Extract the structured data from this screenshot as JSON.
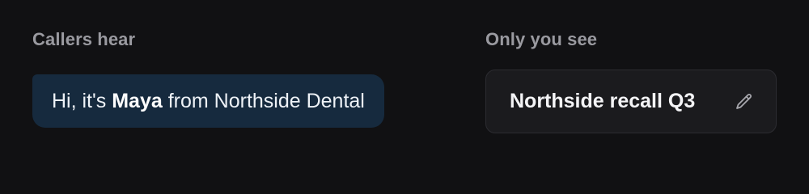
{
  "callers_hear": {
    "label": "Callers hear",
    "greeting_prefix": "Hi, it's ",
    "agent_name": "Maya",
    "greeting_suffix": " from Northside Dental"
  },
  "only_you_see": {
    "label": "Only you see",
    "campaign_name": "Northside recall Q3",
    "edit_icon": "pencil-icon"
  }
}
